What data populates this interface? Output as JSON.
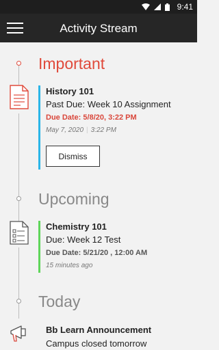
{
  "status_bar": {
    "time": "9:41",
    "icons": [
      "wifi-icon",
      "signal-icon",
      "battery-icon"
    ]
  },
  "app_bar": {
    "title": "Activity Stream",
    "menu_icon": "hamburger-menu-icon"
  },
  "colors": {
    "important": "#e04a3b",
    "important_bar": "#2bb5e8",
    "upcoming_bar": "#5fd65a",
    "app_bar": "#262626"
  },
  "sections": {
    "important": {
      "title": "Important",
      "item": {
        "course": "History 101",
        "title": "Past Due: Week 10 Assignment",
        "due": "Due Date: 5/8/20, 3:22 PM",
        "date": "May 7, 2020",
        "separator": "|",
        "time": "3:22 PM",
        "dismiss_label": "Dismiss"
      }
    },
    "upcoming": {
      "title": "Upcoming",
      "item": {
        "course": "Chemistry 101",
        "title": "Due: Week 12 Test",
        "due": "Due Date: 5/21/20 , 12:00 AM",
        "relative_time": "15 minutes ago"
      }
    },
    "today": {
      "title": "Today",
      "item": {
        "title": "Bb Learn Announcement",
        "body": "Campus closed tomorrow"
      }
    }
  }
}
